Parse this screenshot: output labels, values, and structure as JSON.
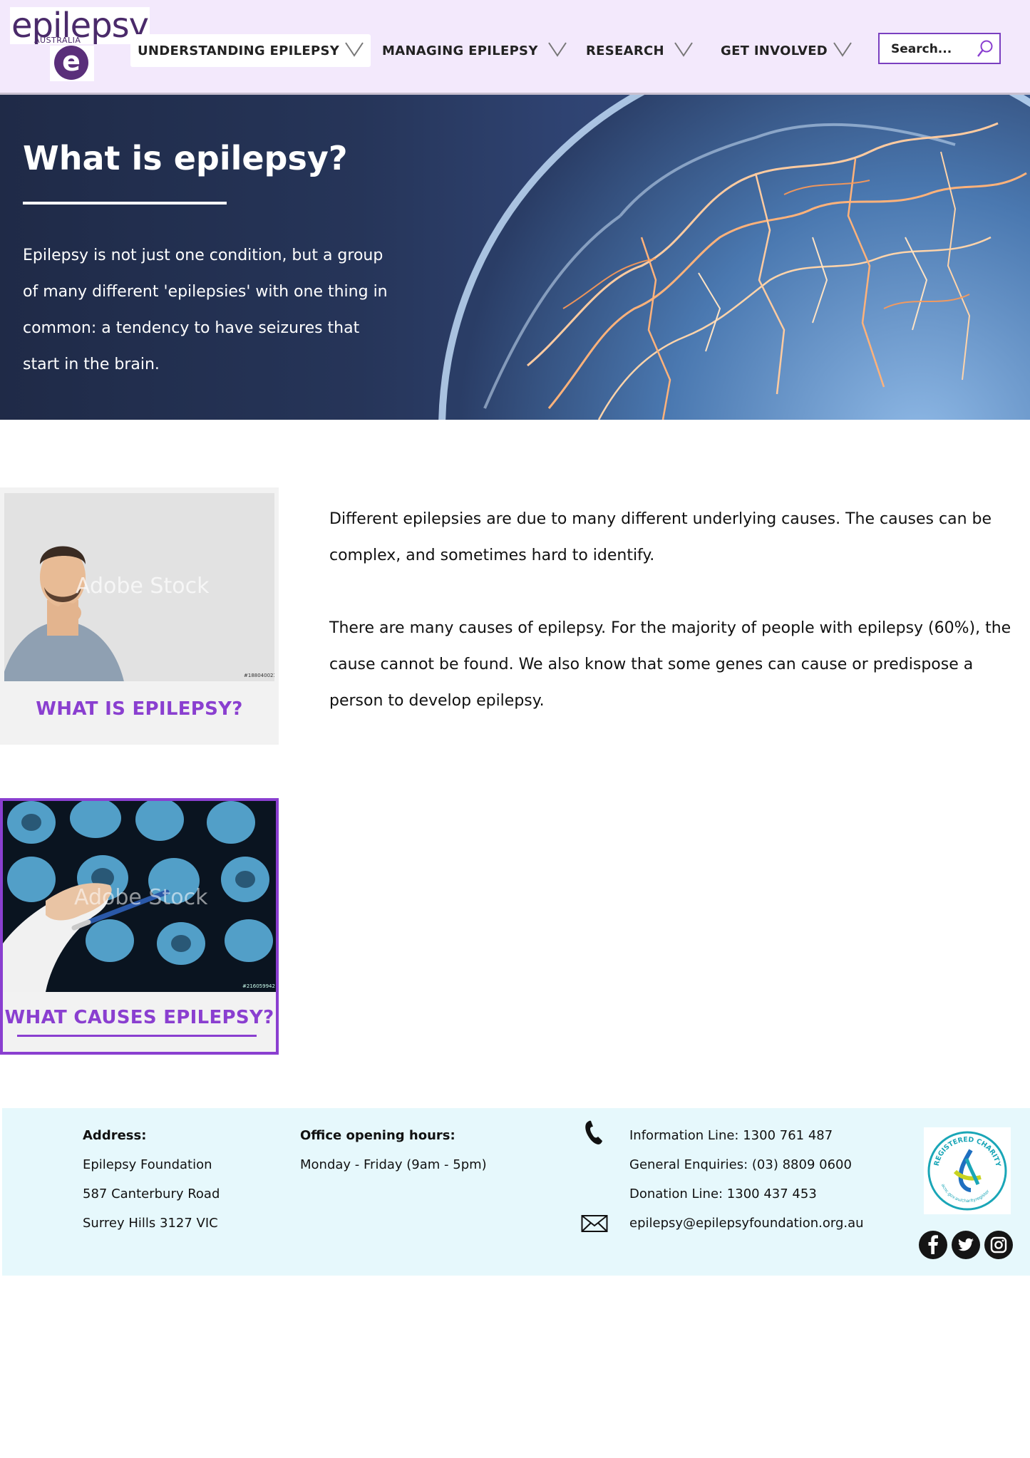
{
  "logo": {
    "word": "epilepsy",
    "sub": "AUSTRALIA",
    "mark": "e"
  },
  "nav": {
    "items": [
      {
        "label": "UNDERSTANDING EPILEPSY",
        "active": true
      },
      {
        "label": "MANAGING EPILEPSY"
      },
      {
        "label": "RESEARCH"
      },
      {
        "label": "GET INVOLVED"
      }
    ],
    "chevron_icon": "chevron-down-icon"
  },
  "search": {
    "placeholder": "Search...",
    "icon": "search-icon"
  },
  "hero": {
    "title": "What is epilepsy?",
    "text": "Epilepsy is not just one condition, but a group of many different 'epilepsies' with one thing in common: a tendency to have seizures that start in the brain."
  },
  "cards": [
    {
      "label": "WHAT IS EPILEPSY?",
      "stock_id": "#188040023"
    },
    {
      "label": "WHAT CAUSES EPILEPSY?",
      "stock_id": "#216059942",
      "selected": true
    }
  ],
  "watermark": "Adobe Stock",
  "content": {
    "para1": "Different epilepsies are due to many different underlying causes. The causes can be complex, and sometimes hard to identify.",
    "para2": "There are many causes of epilepsy.  For the majority of people with epilepsy (60%), the cause cannot be found. We also know that some genes can cause or predispose a person to develop epilepsy."
  },
  "footer": {
    "address": {
      "heading": "Address:",
      "lines": [
        "Epilepsy Foundation",
        "587 Canterbury Road",
        "Surrey Hills 3127 VIC"
      ]
    },
    "hours": {
      "heading": "Office opening hours:",
      "lines": [
        "Monday - Friday (9am - 5pm)"
      ]
    },
    "contact": {
      "info_line": "Information Line: 1300 761 487",
      "general": "General Enquiries: (03) 8809 0600",
      "donation": "Donation Line: 1300 437 453",
      "email": "epilepsy@epilepsyfoundation.org.au"
    },
    "badge_text": "REGISTERED CHARITY",
    "badge_url": "acnc.gov.au/charityregister",
    "social": [
      "facebook-icon",
      "twitter-icon",
      "instagram-icon"
    ]
  },
  "colors": {
    "header_bg": "#f3e9fc",
    "accent": "#8a3fd0",
    "footer_bg": "#e6f8fc",
    "hero_bg": "#263559"
  }
}
